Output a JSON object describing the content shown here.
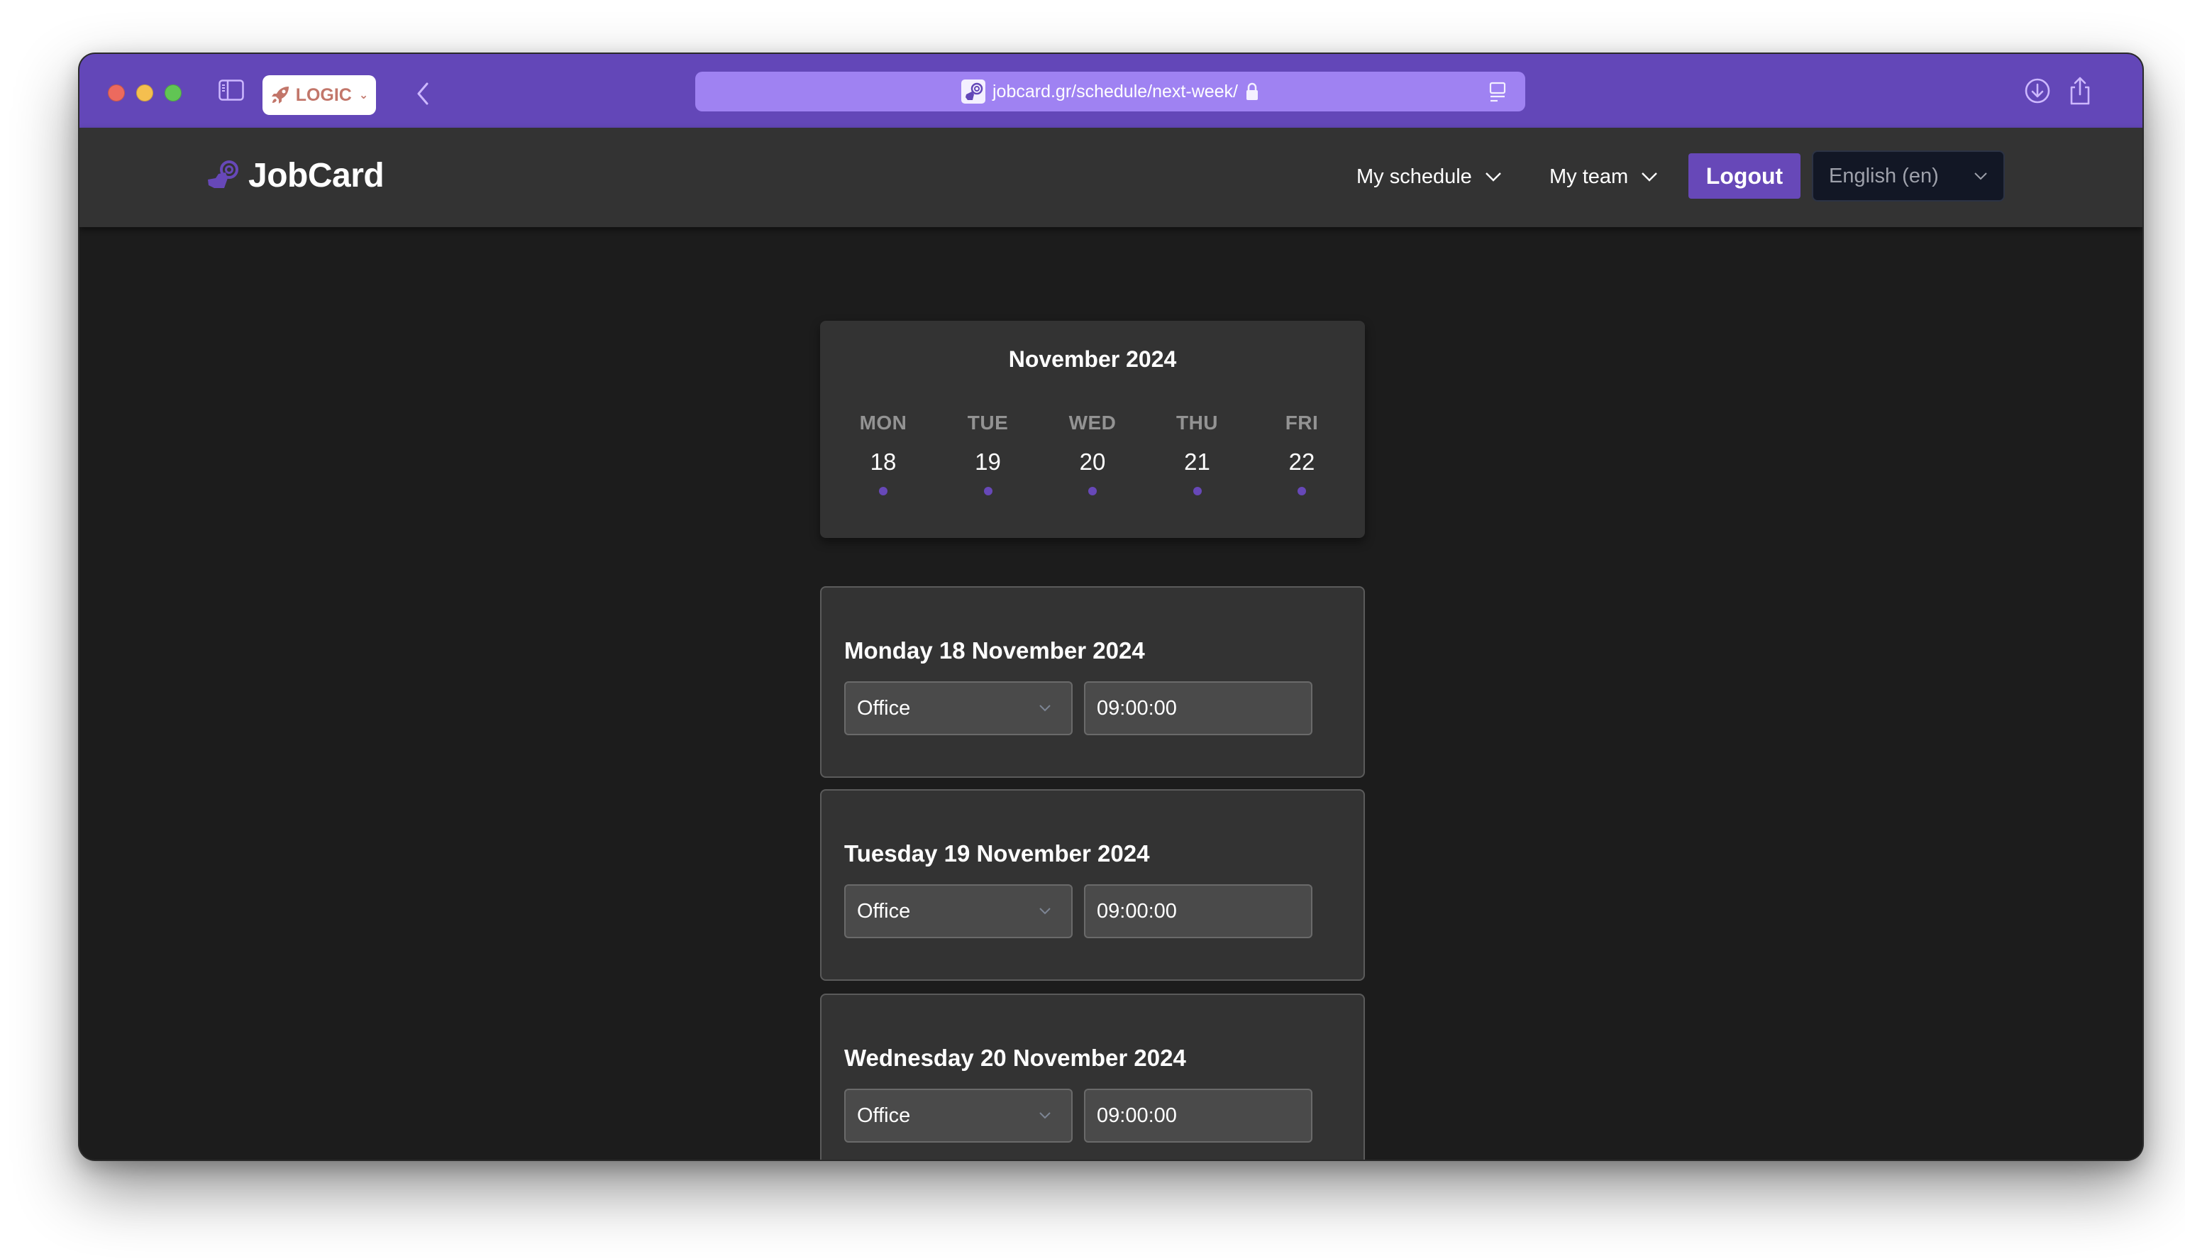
{
  "browser": {
    "tab_group_label": "LOGIC",
    "url": "jobcard.gr/schedule/next-week/",
    "colors": {
      "titlebar": "#6347b8",
      "urlbar": "#9f82f2"
    }
  },
  "app": {
    "brand_name": "JobCard",
    "nav": {
      "my_schedule": "My schedule",
      "my_team": "My team",
      "logout": "Logout",
      "language": "English (en)"
    },
    "accent_color": "#6748b8"
  },
  "calendar": {
    "month_label": "November 2024",
    "days": [
      {
        "dow": "MON",
        "day": "18",
        "has_entry": true
      },
      {
        "dow": "TUE",
        "day": "19",
        "has_entry": true
      },
      {
        "dow": "WED",
        "day": "20",
        "has_entry": true
      },
      {
        "dow": "THU",
        "day": "21",
        "has_entry": true
      },
      {
        "dow": "FRI",
        "day": "22",
        "has_entry": true
      }
    ]
  },
  "schedule": [
    {
      "date_label": "Monday 18 November 2024",
      "location": "Office",
      "time": "09:00:00"
    },
    {
      "date_label": "Tuesday 19 November 2024",
      "location": "Office",
      "time": "09:00:00"
    },
    {
      "date_label": "Wednesday 20 November 2024",
      "location": "Office",
      "time": "09:00:00"
    }
  ]
}
